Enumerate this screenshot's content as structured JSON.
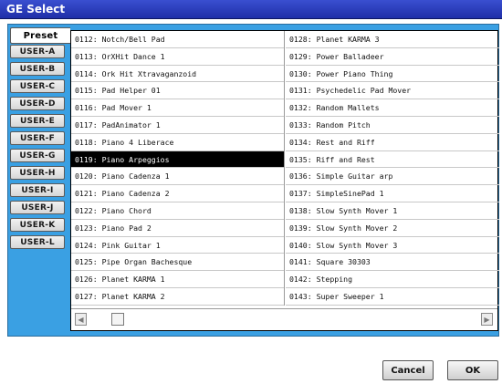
{
  "dialog": {
    "title": "GE Select"
  },
  "tabs": [
    "Preset",
    "USER-A",
    "USER-B",
    "USER-C",
    "USER-D",
    "USER-E",
    "USER-F",
    "USER-G",
    "USER-H",
    "USER-I",
    "USER-J",
    "USER-K",
    "USER-L"
  ],
  "list": {
    "left": [
      "0112: Notch/Bell Pad",
      "0113: OrXHit Dance 1",
      "0114: Ork Hit Xtravaganzoid",
      "0115: Pad Helper 01",
      "0116: Pad Mover 1",
      "0117: PadAnimator 1",
      "0118: Piano 4 Liberace",
      "0119: Piano Arpeggios",
      "0120: Piano Cadenza 1",
      "0121: Piano Cadenza 2",
      "0122: Piano Chord",
      "0123: Piano Pad 2",
      "0124: Pink Guitar 1",
      "0125: Pipe Organ Bachesque",
      "0126: Planet KARMA 1",
      "0127: Planet KARMA 2"
    ],
    "right": [
      "0128: Planet KARMA 3",
      "0129: Power Balladeer",
      "0130: Power Piano Thing",
      "0131: Psychedelic Pad Mover",
      "0132: Random Mallets",
      "0133: Random Pitch",
      "0134: Rest and Riff",
      "0135: Riff and Rest",
      "0136: Simple Guitar arp",
      "0137: SimpleSinePad 1",
      "0138: Slow Synth Mover 1",
      "0139: Slow Synth Mover 2",
      "0140: Slow Synth Mover 3",
      "0141: Square 30303",
      "0142: Stepping",
      "0143: Super Sweeper 1"
    ],
    "selected": "0119: Piano Arpeggios"
  },
  "scroll": {
    "left_icon": "arrow-left-icon",
    "right_icon": "arrow-right-icon",
    "left_glyph": "◀",
    "right_glyph": "▶"
  },
  "buttons": {
    "cancel": "Cancel",
    "ok": "OK"
  }
}
